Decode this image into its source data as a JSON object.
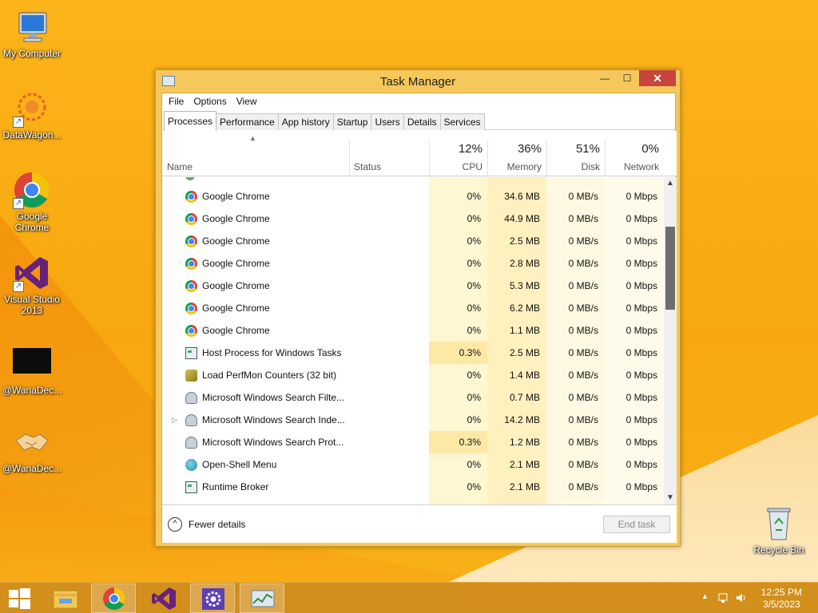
{
  "desktop": {
    "icons": [
      {
        "label": "My Computer",
        "icon": "computer-icon"
      },
      {
        "label": "DataWagon...",
        "icon": "datawagon-icon"
      },
      {
        "label": "Google Chrome",
        "icon": "chrome-icon"
      },
      {
        "label": "Visual Studio 2013",
        "icon": "visual-studio-icon"
      },
      {
        "label": "@WanaDec...",
        "icon": "black-window-icon"
      },
      {
        "label": "@WanaDec...",
        "icon": "handshake-icon"
      },
      {
        "label": "Recycle Bin",
        "icon": "recycle-bin-icon"
      }
    ]
  },
  "window": {
    "title": "Task Manager",
    "controls": {
      "minimize": "—",
      "maximize": "☐",
      "close": "✕"
    },
    "menu": [
      "File",
      "Options",
      "View"
    ],
    "tabs": [
      "Processes",
      "Performance",
      "App history",
      "Startup",
      "Users",
      "Details",
      "Services"
    ],
    "active_tab": "Processes",
    "columns": {
      "name": "Name",
      "status": "Status",
      "cpu": {
        "pct": "12%",
        "label": "CPU"
      },
      "memory": {
        "pct": "36%",
        "label": "Memory"
      },
      "disk": {
        "pct": "51%",
        "label": "Disk"
      },
      "network": {
        "pct": "0%",
        "label": "Network"
      }
    },
    "rows": [
      {
        "name": "Google Chrome",
        "icon": "chrome",
        "cpu": "0%",
        "memory": "34.6 MB",
        "disk": "0 MB/s",
        "network": "0 Mbps"
      },
      {
        "name": "Google Chrome",
        "icon": "chrome",
        "cpu": "0%",
        "memory": "44.9 MB",
        "disk": "0 MB/s",
        "network": "0 Mbps"
      },
      {
        "name": "Google Chrome",
        "icon": "chrome",
        "cpu": "0%",
        "memory": "2.5 MB",
        "disk": "0 MB/s",
        "network": "0 Mbps"
      },
      {
        "name": "Google Chrome",
        "icon": "chrome",
        "cpu": "0%",
        "memory": "2.8 MB",
        "disk": "0 MB/s",
        "network": "0 Mbps"
      },
      {
        "name": "Google Chrome",
        "icon": "chrome",
        "cpu": "0%",
        "memory": "5.3 MB",
        "disk": "0 MB/s",
        "network": "0 Mbps"
      },
      {
        "name": "Google Chrome",
        "icon": "chrome",
        "cpu": "0%",
        "memory": "6.2 MB",
        "disk": "0 MB/s",
        "network": "0 Mbps"
      },
      {
        "name": "Google Chrome",
        "icon": "chrome",
        "cpu": "0%",
        "memory": "1.1 MB",
        "disk": "0 MB/s",
        "network": "0 Mbps"
      },
      {
        "name": "Host Process for Windows Tasks",
        "icon": "host",
        "cpu": "0.3%",
        "memory": "2.5 MB",
        "disk": "0 MB/s",
        "network": "0 Mbps",
        "cpu_highlight": true
      },
      {
        "name": "Load PerfMon Counters (32 bit)",
        "icon": "perf",
        "cpu": "0%",
        "memory": "1.4 MB",
        "disk": "0 MB/s",
        "network": "0 Mbps"
      },
      {
        "name": "Microsoft Windows Search Filte...",
        "icon": "search",
        "cpu": "0%",
        "memory": "0.7 MB",
        "disk": "0 MB/s",
        "network": "0 Mbps"
      },
      {
        "name": "Microsoft Windows Search Inde...",
        "icon": "search",
        "cpu": "0%",
        "memory": "14.2 MB",
        "disk": "0 MB/s",
        "network": "0 Mbps",
        "expandable": true
      },
      {
        "name": "Microsoft Windows Search Prot...",
        "icon": "search",
        "cpu": "0.3%",
        "memory": "1.2 MB",
        "disk": "0 MB/s",
        "network": "0 Mbps",
        "cpu_highlight": true
      },
      {
        "name": "Open-Shell Menu",
        "icon": "shell",
        "cpu": "0%",
        "memory": "2.1 MB",
        "disk": "0 MB/s",
        "network": "0 Mbps"
      },
      {
        "name": "Runtime Broker",
        "icon": "host",
        "cpu": "0%",
        "memory": "2.1 MB",
        "disk": "0 MB/s",
        "network": "0 Mbps"
      }
    ],
    "footer": {
      "fewer_details": "Fewer details",
      "end_task": "End task"
    }
  },
  "taskbar": {
    "items": [
      "start",
      "file-explorer",
      "chrome",
      "visual-studio",
      "settings",
      "task-manager"
    ],
    "active_item": "task-manager",
    "clock": {
      "time": "12:25 PM",
      "date": "3/5/2023"
    }
  },
  "colors": {
    "accent": "#f6c85b",
    "close": "#c7453d",
    "cpu_col": "#fff6d2",
    "mem_col": "#fff0bf",
    "cpu_highlight": "#fde9a5"
  }
}
